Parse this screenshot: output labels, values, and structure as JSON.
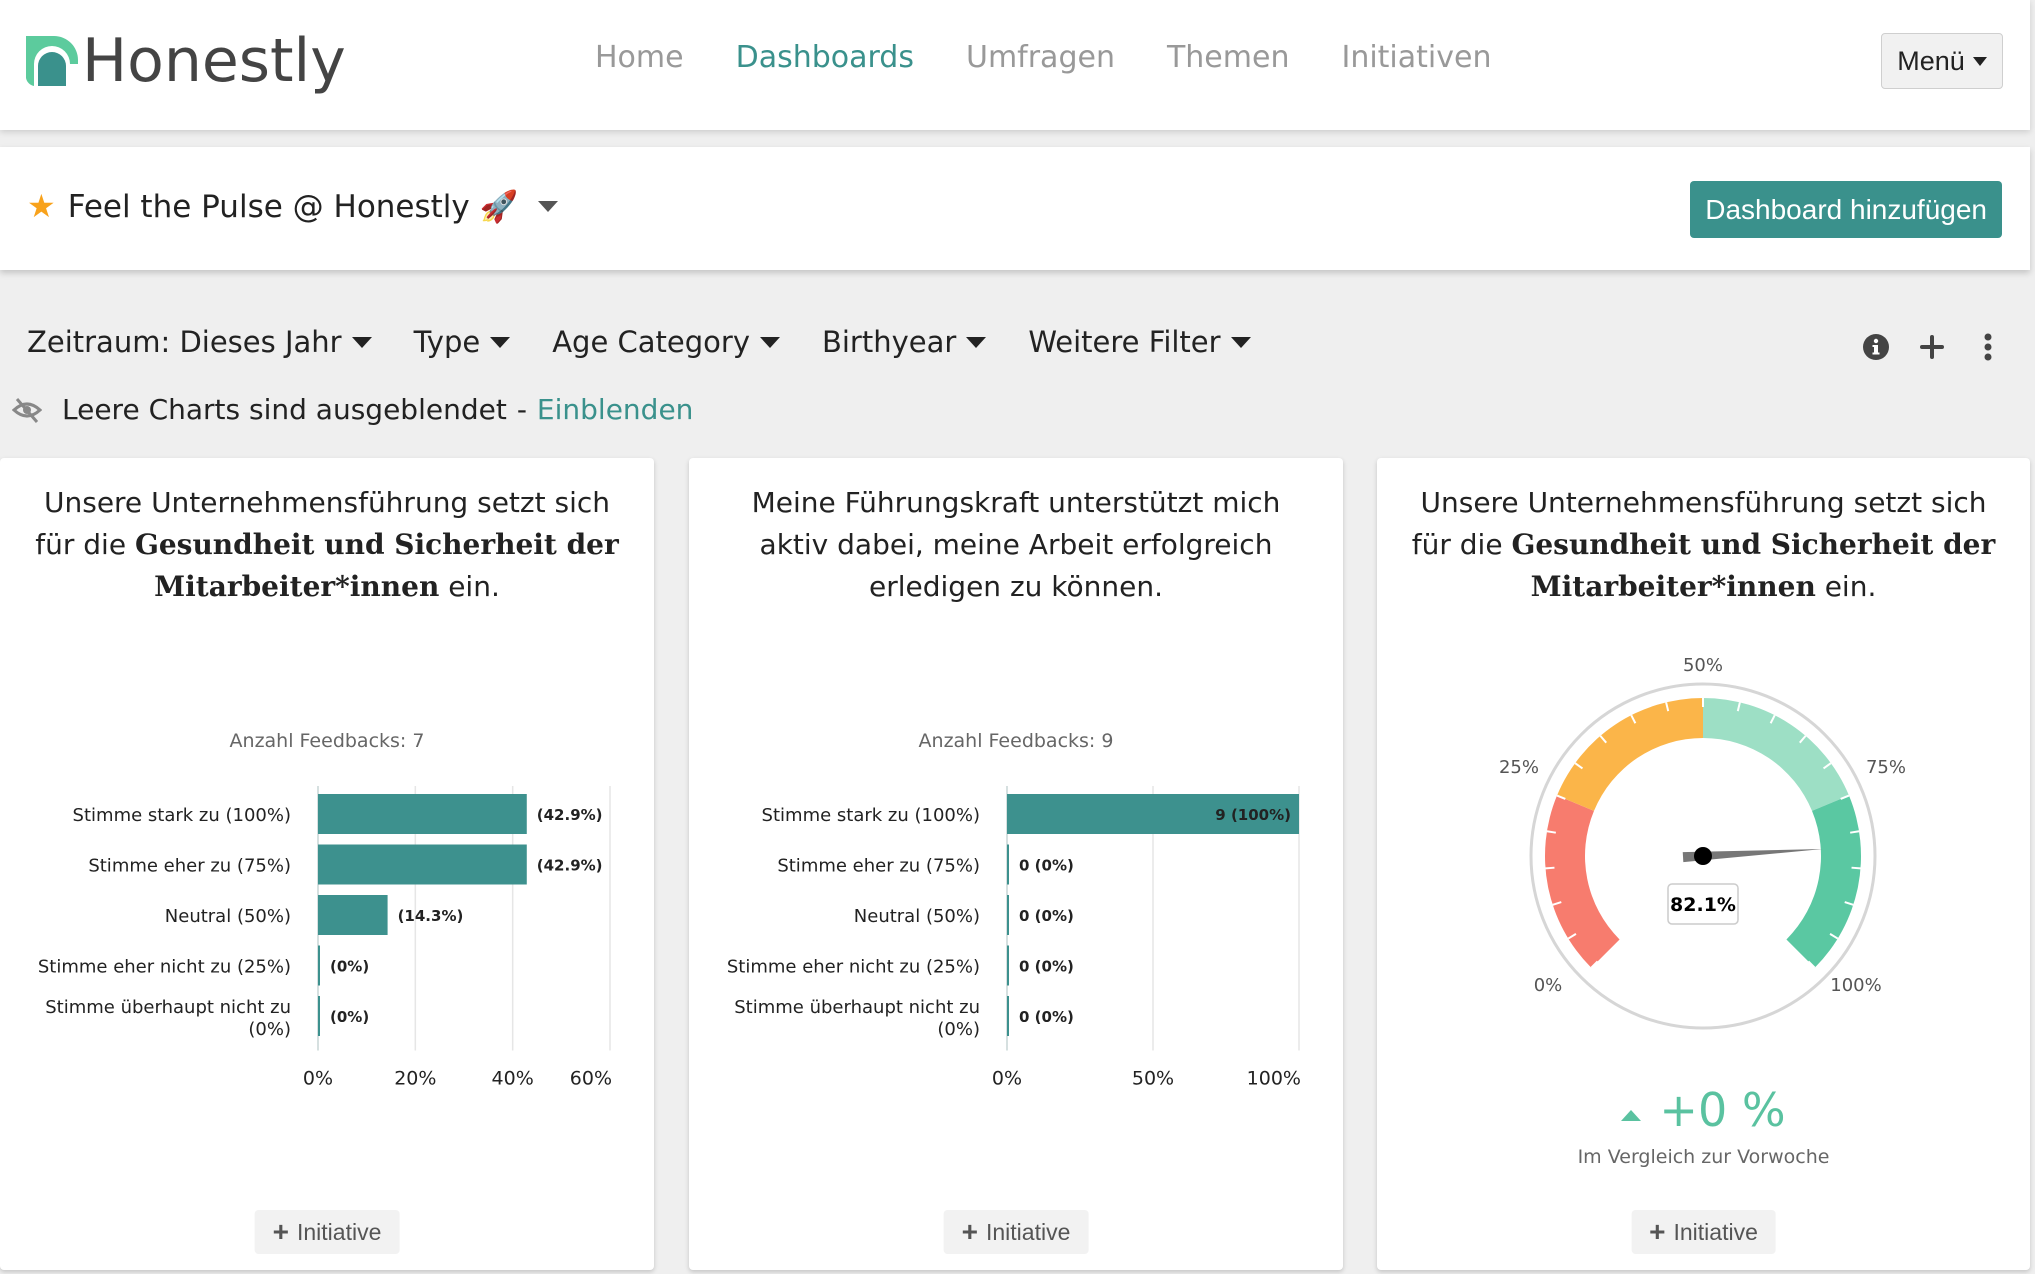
{
  "header": {
    "logo_text": "Honestly",
    "nav": [
      {
        "label": "Home",
        "active": false
      },
      {
        "label": "Dashboards",
        "active": true
      },
      {
        "label": "Umfragen",
        "active": false
      },
      {
        "label": "Themen",
        "active": false
      },
      {
        "label": "Initiativen",
        "active": false
      }
    ],
    "menu_label": "Menü"
  },
  "dashboard": {
    "title": "Feel the Pulse @ Honestly 🚀",
    "star_icon": "star-icon",
    "add_button": "Dashboard hinzufügen"
  },
  "filters": [
    {
      "label": "Zeitraum: Dieses Jahr"
    },
    {
      "label": "Type"
    },
    {
      "label": "Age Category"
    },
    {
      "label": "Birthyear"
    },
    {
      "label": "Weitere Filter"
    }
  ],
  "toolbar_icons": [
    "info-icon",
    "plus-icon",
    "more-vertical-icon"
  ],
  "notice": {
    "text": "Leere Charts sind ausgeblendet",
    "separator": "-",
    "link": "Einblenden"
  },
  "colors": {
    "brand": "#3a918c",
    "bar": "#3d918e",
    "gauge_red": "#f77c6e",
    "gauge_orange": "#fbb549",
    "gauge_light_green": "#9ddfc5",
    "gauge_green": "#5ac8a2",
    "delta_green": "#5ac2a0"
  },
  "cards": [
    {
      "title_pre": "Unsere Unternehmensführung setzt sich für die ",
      "title_bold": "Gesundheit und Sicherheit der Mitarbeiter*innen",
      "title_post": " ein.",
      "feedback_count": "Anzahl Feedbacks: 7",
      "initiative_label": "Initiative"
    },
    {
      "title_pre": "Meine Führungskraft unterstützt mich aktiv dabei, meine Arbeit erfolgreich erledigen zu können.",
      "title_bold": "",
      "title_post": "",
      "feedback_count": "Anzahl Feedbacks: 9",
      "initiative_label": "Initiative"
    },
    {
      "title_pre": "Unsere Unternehmensführung setzt sich für die ",
      "title_bold": "Gesundheit und Sicherheit der Mitarbeiter*innen",
      "title_post": " ein.",
      "delta_value": "+0 %",
      "delta_label": "Im Vergleich zur Vorwoche",
      "initiative_label": "Initiative"
    }
  ],
  "chart_data": [
    {
      "type": "bar",
      "orientation": "horizontal",
      "categories": [
        "Stimme stark zu (100%)",
        "Stimme eher zu (75%)",
        "Neutral (50%)",
        "Stimme eher nicht zu (25%)",
        "Stimme überhaupt nicht zu (0%)"
      ],
      "values": [
        42.9,
        42.9,
        14.3,
        0,
        0
      ],
      "data_labels": [
        "(42.9%)",
        "(42.9%)",
        "(14.3%)",
        "(0%)",
        "(0%)"
      ],
      "xlim": [
        0,
        60
      ],
      "xticks": [
        "0%",
        "20%",
        "40%",
        "60%"
      ],
      "xtick_values": [
        0,
        20,
        40,
        60
      ],
      "title": "Anzahl Feedbacks: 7",
      "grid": true
    },
    {
      "type": "bar",
      "orientation": "horizontal",
      "categories": [
        "Stimme stark zu (100%)",
        "Stimme eher zu (75%)",
        "Neutral (50%)",
        "Stimme eher nicht zu (25%)",
        "Stimme überhaupt nicht zu (0%)"
      ],
      "values": [
        100,
        0,
        0,
        0,
        0
      ],
      "counts": [
        9,
        0,
        0,
        0,
        0
      ],
      "data_labels": [
        "9 (100%)",
        "0 (0%)",
        "0 (0%)",
        "0 (0%)",
        "0 (0%)"
      ],
      "xlim": [
        0,
        100
      ],
      "xticks": [
        "0%",
        "50%",
        "100%"
      ],
      "xtick_values": [
        0,
        50,
        100
      ],
      "title": "Anzahl Feedbacks: 9",
      "grid": true
    },
    {
      "type": "gauge",
      "value": 82.1,
      "value_label": "82.1%",
      "range": [
        0,
        100
      ],
      "tick_labels": [
        "0%",
        "25%",
        "50%",
        "75%",
        "100%"
      ],
      "tick_values": [
        0,
        25,
        50,
        75,
        100
      ],
      "bands": [
        {
          "from": 0,
          "to": 25,
          "color": "#f77c6e"
        },
        {
          "from": 25,
          "to": 50,
          "color": "#fbb549"
        },
        {
          "from": 50,
          "to": 75,
          "color": "#9ddfc5"
        },
        {
          "from": 75,
          "to": 100,
          "color": "#5ac8a2"
        }
      ]
    }
  ]
}
